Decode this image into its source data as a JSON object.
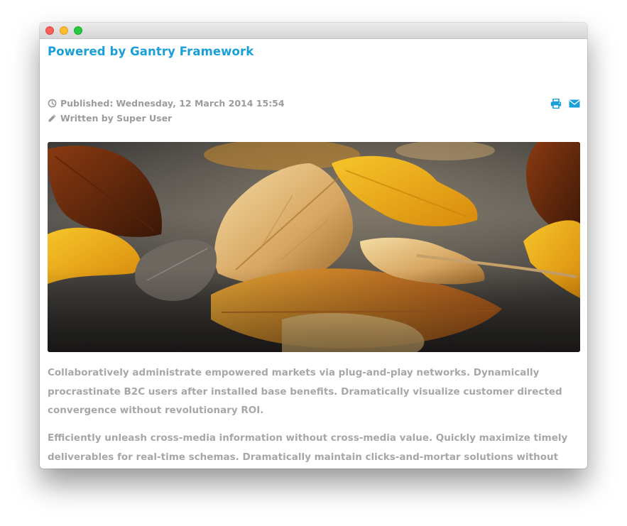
{
  "window": {
    "traffic_lights": {
      "close_color": "#fc5f57",
      "minimize_color": "#fdbc2e",
      "maximize_color": "#28c840"
    }
  },
  "article": {
    "title": "Powered by Gantry Framework",
    "published_label": "Published:",
    "published_date": "Wednesday, 12 March 2014 15:54",
    "author_text": "Written by Super User",
    "icons": {
      "published": "clock-icon",
      "author": "pencil-icon",
      "print": "print-icon",
      "email": "envelope-icon"
    },
    "image": {
      "subject": "autumn-leaves-photo"
    },
    "paragraphs": [
      "Collaboratively administrate empowered markets via plug-and-play networks. Dynamically procrastinate B2C users after installed base benefits. Dramatically visualize customer directed convergence without revolutionary ROI.",
      "Efficiently unleash cross-media information without cross-media value. Quickly maximize timely deliverables for real-time schemas. Dramatically maintain clicks-and-mortar solutions without functional solutions."
    ]
  },
  "colors": {
    "accent": "#1a9fd9",
    "meta_text": "#9c9c9c",
    "body_text": "#a7a7a7"
  }
}
